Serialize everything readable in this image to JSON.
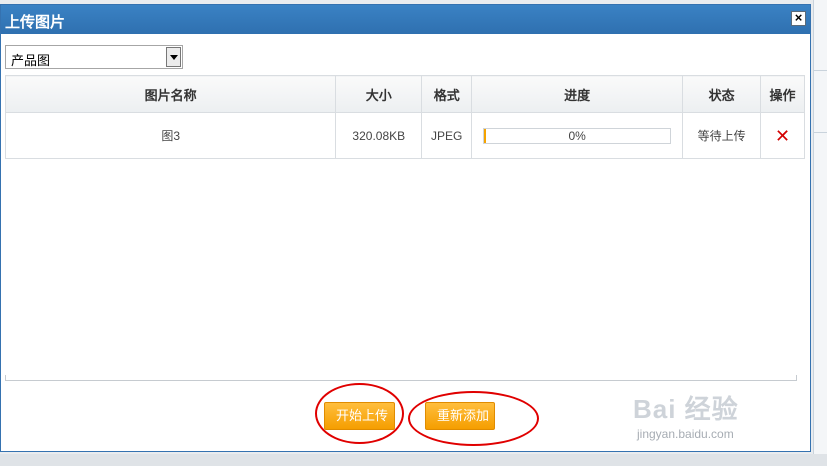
{
  "dialog": {
    "title": "上传图片",
    "close_label": "×"
  },
  "category_select": {
    "selected": "产品图"
  },
  "table": {
    "headers": [
      "图片名称",
      "大小",
      "格式",
      "进度",
      "状态",
      "操作"
    ],
    "rows": [
      {
        "name": "图3",
        "size": "320.08KB",
        "format": "JPEG",
        "progress_text": "0%",
        "progress_value": 0,
        "status": "等待上传",
        "action": "✕"
      }
    ]
  },
  "buttons": {
    "start_upload": "开始上传",
    "re_add": "重新添加"
  },
  "watermark": {
    "main": "Bai 经验",
    "sub": "jingyan.baidu.com"
  },
  "colors": {
    "titlebar": "#2f70b0",
    "button": "#f59e00",
    "delete": "#d40000",
    "annotation_circle": "#e00000"
  }
}
